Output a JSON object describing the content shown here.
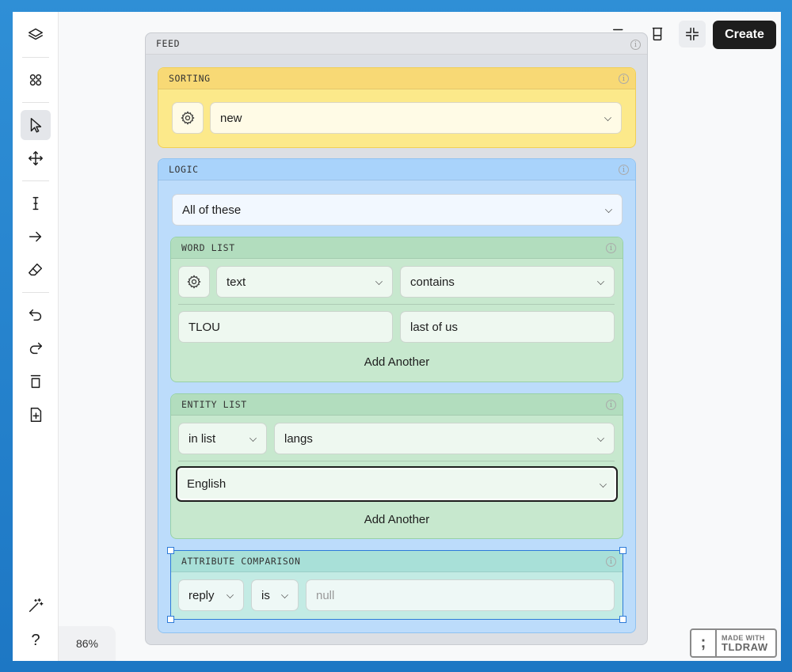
{
  "zoom": "86%",
  "create_label": "Create",
  "branding": {
    "line1": "MADE WITH",
    "line2": "TLDRAW"
  },
  "feed": {
    "title": "FEED",
    "sorting": {
      "title": "SORTING",
      "value": "new"
    },
    "logic": {
      "title": "LOGIC",
      "mode": "All of these",
      "word_list": {
        "title": "WORD LIST",
        "field": "text",
        "operator": "contains",
        "words": [
          "TLOU",
          "last of us"
        ],
        "add_label": "Add Another"
      },
      "entity_list": {
        "title": "ENTITY LIST",
        "operator": "in list",
        "list": "langs",
        "value": "English",
        "add_label": "Add Another"
      },
      "attribute_comparison": {
        "title": "ATTRIBUTE COMPARISON",
        "attribute": "reply",
        "operator": "is",
        "value_placeholder": "null"
      }
    }
  },
  "help_label": "?",
  "info_glyph": "i"
}
